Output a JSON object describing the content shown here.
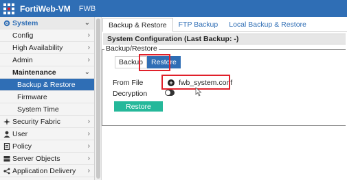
{
  "header": {
    "title": "FortiWeb-VM",
    "subtitle": "FWB",
    "bg_color": "#2f6eb5",
    "logo_icon": "fortinet-logo-icon"
  },
  "sidebar": {
    "items": [
      {
        "label": "System",
        "icon": "gear-icon",
        "chevron": "⌄"
      },
      {
        "label": "Config",
        "chevron": "›"
      },
      {
        "label": "High Availability",
        "chevron": "›"
      },
      {
        "label": "Admin",
        "chevron": "›"
      },
      {
        "label": "Maintenance",
        "chevron": "⌄"
      },
      {
        "label": "Backup & Restore"
      },
      {
        "label": "Firmware"
      },
      {
        "label": "System Time"
      },
      {
        "label": "Security Fabric",
        "icon": "fabric-icon",
        "chevron": "›"
      },
      {
        "label": "User",
        "icon": "user-icon",
        "chevron": "›"
      },
      {
        "label": "Policy",
        "icon": "policy-icon",
        "chevron": "›"
      },
      {
        "label": "Server Objects",
        "icon": "server-icon",
        "chevron": "›"
      },
      {
        "label": "Application Delivery",
        "icon": "delivery-icon",
        "chevron": "›"
      }
    ]
  },
  "tabs": [
    {
      "label": "Backup & Restore"
    },
    {
      "label": "FTP Backup"
    },
    {
      "label": "Local Backup & Restore"
    }
  ],
  "section": {
    "title": "System Configuration (Last Backup: -)",
    "legend": "Backup/Restore"
  },
  "form": {
    "backup_label": "Backup",
    "restore_label": "Restore",
    "from_file_label": "From File",
    "file_name": "fwb_system.conf",
    "decryption_label": "Decryption",
    "submit_label": "Restore",
    "accent_color": "#2f6eb5",
    "submit_color": "#25b89a",
    "highlight_color": "#e0202a"
  }
}
